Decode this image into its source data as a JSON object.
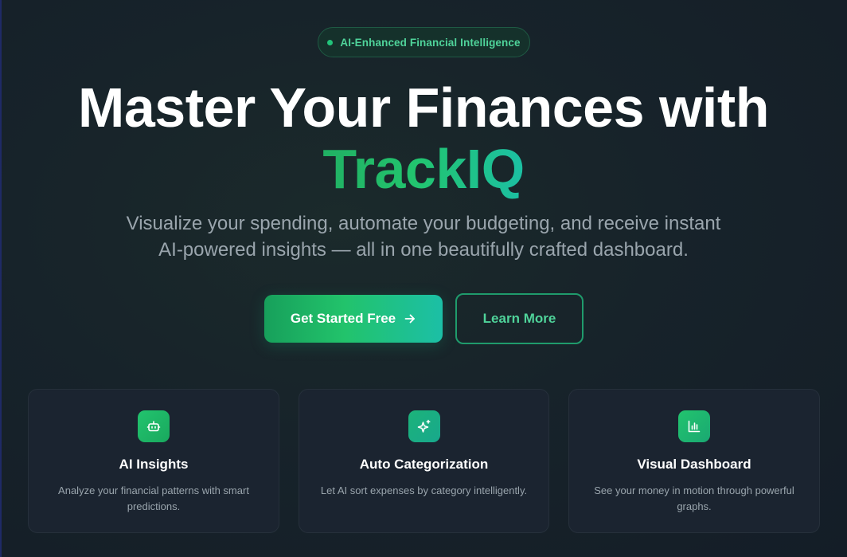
{
  "badge": {
    "text": "AI-Enhanced Financial Intelligence"
  },
  "hero": {
    "headline": "Master Your Finances with",
    "brand": "TrackIQ",
    "subtitle_line1": "Visualize your spending, automate your budgeting, and receive instant",
    "subtitle_line2": "AI-powered insights — all in one beautifully crafted dashboard."
  },
  "actions": {
    "primary_label": "Get Started Free",
    "primary_icon": "arrow-right-icon",
    "secondary_label": "Learn More"
  },
  "features": [
    {
      "icon": "robot-icon",
      "title": "AI Insights",
      "description": "Analyze your financial patterns with smart predictions."
    },
    {
      "icon": "sparkles-icon",
      "title": "Auto Categorization",
      "description": "Let AI sort expenses by category intelligently."
    },
    {
      "icon": "bar-chart-icon",
      "title": "Visual Dashboard",
      "description": "See your money in motion through powerful graphs."
    }
  ],
  "colors": {
    "accent_green": "#22c46e",
    "accent_teal": "#1cbfa6",
    "badge_text": "#4fd39a",
    "background": "#17232a",
    "card_background": "#1b2430",
    "muted_text": "#9aa5ad"
  }
}
